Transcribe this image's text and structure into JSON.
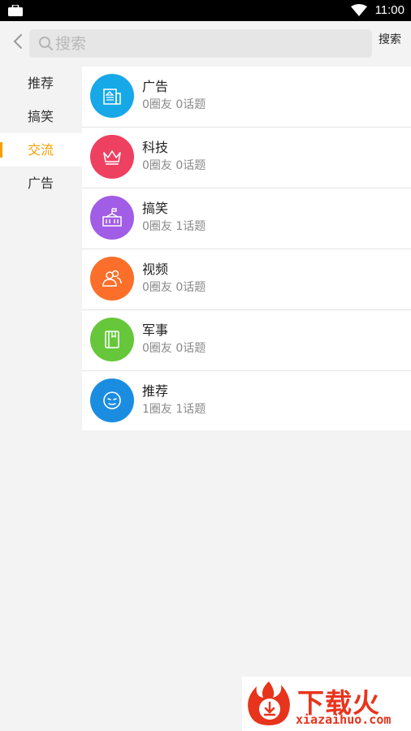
{
  "status_bar": {
    "time": "11:00",
    "icons": [
      "briefcase-icon",
      "wifi-icon",
      "battery-icon"
    ]
  },
  "header": {
    "back_icon": "chevron-left-icon",
    "search_placeholder": "搜索",
    "search_value": "",
    "search_button": "搜索"
  },
  "sidebar": {
    "accent_color": "#f5a000",
    "active_index": 2,
    "items": [
      {
        "label": "推荐"
      },
      {
        "label": "搞笑"
      },
      {
        "label": "交流"
      },
      {
        "label": "广告"
      }
    ]
  },
  "groups": [
    {
      "name": "广告",
      "meta": "0圈友  0话题",
      "color": "#17a8e8",
      "icon": "newspaper-icon"
    },
    {
      "name": "科技",
      "meta": "0圈友  0话题",
      "color": "#ee4060",
      "icon": "crown-icon"
    },
    {
      "name": "搞笑",
      "meta": "0圈友  1话题",
      "color": "#a15de6",
      "icon": "school-icon"
    },
    {
      "name": "视频",
      "meta": "0圈友  0话题",
      "color": "#fb6f2a",
      "icon": "people-icon"
    },
    {
      "name": "军事",
      "meta": "0圈友  0话题",
      "color": "#66c73a",
      "icon": "book-icon"
    },
    {
      "name": "推荐",
      "meta": "1圈友  1话题",
      "color": "#1b8de0",
      "icon": "face-icon"
    }
  ],
  "watermark": {
    "title": "下载火",
    "subtitle": "xiazaihuo.com",
    "color": "#e8341c"
  }
}
